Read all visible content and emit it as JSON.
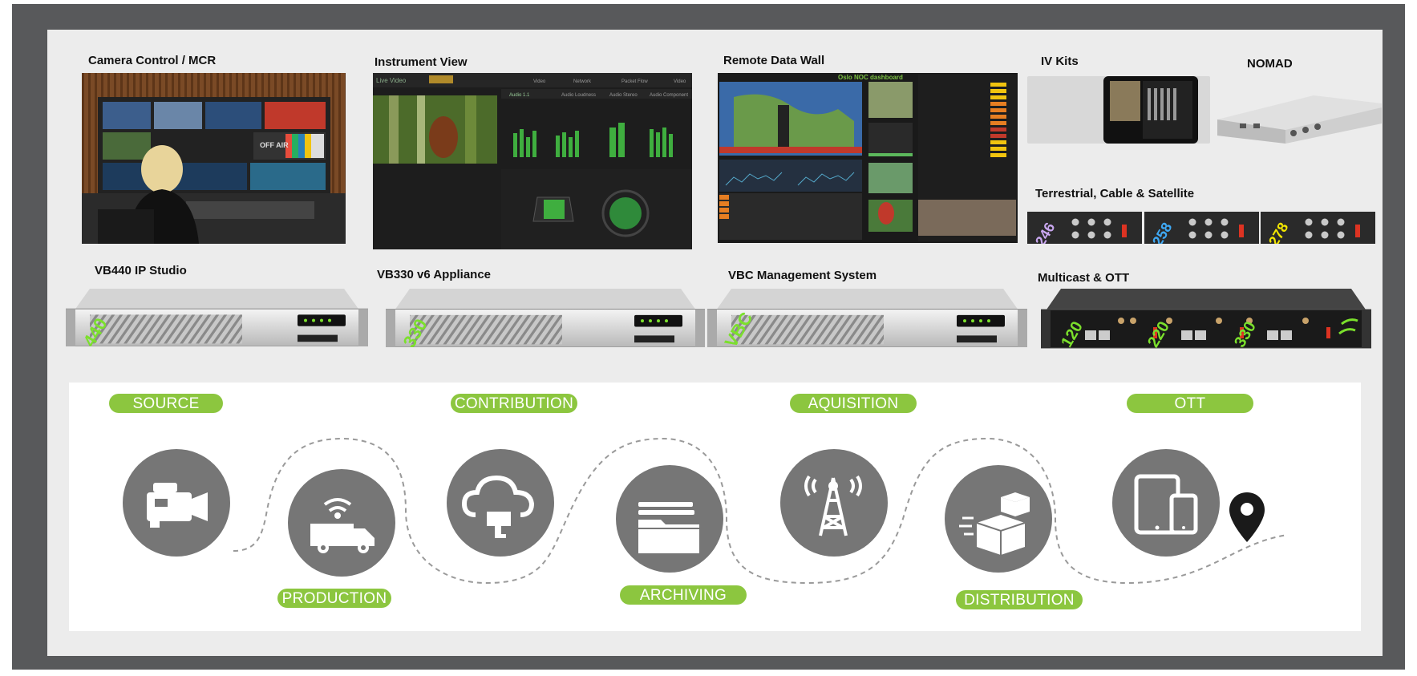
{
  "labels": {
    "camera_control": "Camera Control / MCR",
    "instrument_view": "Instrument View",
    "remote_data_wall": "Remote Data Wall",
    "iv_kits": "IV Kits",
    "nomad": "NOMAD",
    "terrestrial": "Terrestrial, Cable & Satellite",
    "vb440": "VB440 IP Studio",
    "vb330": "VB330 v6 Appliance",
    "vbc": "VBC Management System",
    "multicast": "Multicast & OTT"
  },
  "screens": {
    "camera_air": "OFF AIR",
    "iv_tabs": [
      "Live Video",
      "Video",
      "Network",
      "Packet Flow",
      "Video"
    ],
    "iv_audio_tabs": [
      "Audio 1.1",
      "Audio Loudness",
      "Audio Stereo",
      "Audio Component"
    ],
    "dashboard_title": "Oslo NOC dashboard"
  },
  "racks": {
    "vb440_badge": "440",
    "vb330_badge": "330",
    "vbc_badge": "VBC",
    "multicast_badges": [
      "120",
      "220",
      "330"
    ],
    "terrestrial_badges": [
      "246",
      "258",
      "278"
    ]
  },
  "flow": {
    "stages": [
      {
        "label": "SOURCE",
        "icon": "video-camera-icon"
      },
      {
        "label": "PRODUCTION",
        "icon": "broadcast-van-icon"
      },
      {
        "label": "CONTRIBUTION",
        "icon": "cloud-upload-icon"
      },
      {
        "label": "ARCHIVING",
        "icon": "archive-folder-icon"
      },
      {
        "label": "AQUISITION",
        "icon": "antenna-tower-icon"
      },
      {
        "label": "DISTRIBUTION",
        "icon": "boxes-icon"
      },
      {
        "label": "OTT",
        "icon": "devices-icon"
      }
    ],
    "end_icon": "location-pin-icon"
  },
  "colors": {
    "frame": "#58595b",
    "panel": "#ececec",
    "accent_green": "#8cc63f",
    "circle_grey": "#767676",
    "badge_green": "#7be02c",
    "badge_blue": "#3fa9f5",
    "badge_purple": "#c9a7f0",
    "badge_yellow": "#f2e600"
  }
}
